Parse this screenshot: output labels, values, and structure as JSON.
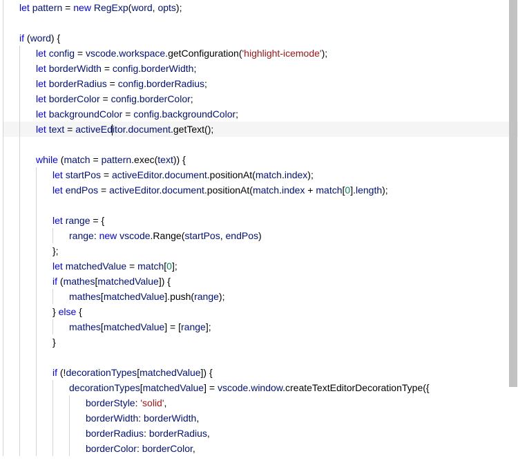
{
  "colors": {
    "keyword": "#0000ff",
    "identifier": "#001080",
    "string": "#a31515",
    "number": "#098658",
    "text": "#000000",
    "bg": "#ffffff",
    "lineHighlight": "#f5f5f5",
    "indentGuide": "#d4d4d4"
  },
  "cursorLineIndex": 8,
  "lines": [
    {
      "indent": 1,
      "tokens": [
        [
          "kw",
          "let"
        ],
        [
          "punct",
          " "
        ],
        [
          "id",
          "pattern"
        ],
        [
          "punct",
          " = "
        ],
        [
          "kw",
          "new"
        ],
        [
          "punct",
          " "
        ],
        [
          "id",
          "RegExp"
        ],
        [
          "punct",
          "("
        ],
        [
          "id",
          "word"
        ],
        [
          "punct",
          ", "
        ],
        [
          "id",
          "opts"
        ],
        [
          "punct",
          ");"
        ]
      ]
    },
    {
      "indent": 1,
      "tokens": []
    },
    {
      "indent": 1,
      "tokens": [
        [
          "kw",
          "if"
        ],
        [
          "punct",
          " ("
        ],
        [
          "id",
          "word"
        ],
        [
          "punct",
          ") {"
        ]
      ]
    },
    {
      "indent": 2,
      "tokens": [
        [
          "kw",
          "let"
        ],
        [
          "punct",
          " "
        ],
        [
          "id",
          "config"
        ],
        [
          "punct",
          " = "
        ],
        [
          "id",
          "vscode"
        ],
        [
          "punct",
          "."
        ],
        [
          "id",
          "workspace"
        ],
        [
          "punct",
          "."
        ],
        [
          "fn",
          "getConfiguration"
        ],
        [
          "punct",
          "("
        ],
        [
          "str",
          "'highlight-icemode'"
        ],
        [
          "punct",
          ");"
        ]
      ]
    },
    {
      "indent": 2,
      "tokens": [
        [
          "kw",
          "let"
        ],
        [
          "punct",
          " "
        ],
        [
          "id",
          "borderWidth"
        ],
        [
          "punct",
          " = "
        ],
        [
          "id",
          "config"
        ],
        [
          "punct",
          "."
        ],
        [
          "id",
          "borderWidth"
        ],
        [
          "punct",
          ";"
        ]
      ]
    },
    {
      "indent": 2,
      "tokens": [
        [
          "kw",
          "let"
        ],
        [
          "punct",
          " "
        ],
        [
          "id",
          "borderRadius"
        ],
        [
          "punct",
          " = "
        ],
        [
          "id",
          "config"
        ],
        [
          "punct",
          "."
        ],
        [
          "id",
          "borderRadius"
        ],
        [
          "punct",
          ";"
        ]
      ]
    },
    {
      "indent": 2,
      "tokens": [
        [
          "kw",
          "let"
        ],
        [
          "punct",
          " "
        ],
        [
          "id",
          "borderColor"
        ],
        [
          "punct",
          " = "
        ],
        [
          "id",
          "config"
        ],
        [
          "punct",
          "."
        ],
        [
          "id",
          "borderColor"
        ],
        [
          "punct",
          ";"
        ]
      ]
    },
    {
      "indent": 2,
      "tokens": [
        [
          "kw",
          "let"
        ],
        [
          "punct",
          " "
        ],
        [
          "id",
          "backgroundColor"
        ],
        [
          "punct",
          " = "
        ],
        [
          "id",
          "config"
        ],
        [
          "punct",
          "."
        ],
        [
          "id",
          "backgroundColor"
        ],
        [
          "punct",
          ";"
        ]
      ]
    },
    {
      "indent": 2,
      "tokens": [
        [
          "kw",
          "let"
        ],
        [
          "punct",
          " "
        ],
        [
          "id",
          "text"
        ],
        [
          "punct",
          " = "
        ],
        [
          "id",
          "activeEd"
        ],
        [
          "cursor",
          ""
        ],
        [
          "id",
          "itor"
        ],
        [
          "punct",
          "."
        ],
        [
          "id",
          "document"
        ],
        [
          "punct",
          "."
        ],
        [
          "fn",
          "getText"
        ],
        [
          "punct",
          "();"
        ]
      ]
    },
    {
      "indent": 2,
      "tokens": []
    },
    {
      "indent": 2,
      "tokens": [
        [
          "kw",
          "while"
        ],
        [
          "punct",
          " ("
        ],
        [
          "id",
          "match"
        ],
        [
          "punct",
          " = "
        ],
        [
          "id",
          "pattern"
        ],
        [
          "punct",
          "."
        ],
        [
          "fn",
          "exec"
        ],
        [
          "punct",
          "("
        ],
        [
          "id",
          "text"
        ],
        [
          "punct",
          ")) {"
        ]
      ]
    },
    {
      "indent": 3,
      "tokens": [
        [
          "kw",
          "let"
        ],
        [
          "punct",
          " "
        ],
        [
          "id",
          "startPos"
        ],
        [
          "punct",
          " = "
        ],
        [
          "id",
          "activeEditor"
        ],
        [
          "punct",
          "."
        ],
        [
          "id",
          "document"
        ],
        [
          "punct",
          "."
        ],
        [
          "fn",
          "positionAt"
        ],
        [
          "punct",
          "("
        ],
        [
          "id",
          "match"
        ],
        [
          "punct",
          "."
        ],
        [
          "id",
          "index"
        ],
        [
          "punct",
          ");"
        ]
      ]
    },
    {
      "indent": 3,
      "tokens": [
        [
          "kw",
          "let"
        ],
        [
          "punct",
          " "
        ],
        [
          "id",
          "endPos"
        ],
        [
          "punct",
          " = "
        ],
        [
          "id",
          "activeEditor"
        ],
        [
          "punct",
          "."
        ],
        [
          "id",
          "document"
        ],
        [
          "punct",
          "."
        ],
        [
          "fn",
          "positionAt"
        ],
        [
          "punct",
          "("
        ],
        [
          "id",
          "match"
        ],
        [
          "punct",
          "."
        ],
        [
          "id",
          "index"
        ],
        [
          "punct",
          " + "
        ],
        [
          "id",
          "match"
        ],
        [
          "punct",
          "["
        ],
        [
          "num",
          "0"
        ],
        [
          "punct",
          "]."
        ],
        [
          "id",
          "length"
        ],
        [
          "punct",
          ");"
        ]
      ]
    },
    {
      "indent": 3,
      "tokens": []
    },
    {
      "indent": 3,
      "tokens": [
        [
          "kw",
          "let"
        ],
        [
          "punct",
          " "
        ],
        [
          "id",
          "range"
        ],
        [
          "punct",
          " = {"
        ]
      ]
    },
    {
      "indent": 4,
      "tokens": [
        [
          "id",
          "range"
        ],
        [
          "punct",
          ": "
        ],
        [
          "kw",
          "new"
        ],
        [
          "punct",
          " "
        ],
        [
          "id",
          "vscode"
        ],
        [
          "punct",
          "."
        ],
        [
          "fn",
          "Range"
        ],
        [
          "punct",
          "("
        ],
        [
          "id",
          "startPos"
        ],
        [
          "punct",
          ", "
        ],
        [
          "id",
          "endPos"
        ],
        [
          "punct",
          ")"
        ]
      ]
    },
    {
      "indent": 3,
      "tokens": [
        [
          "punct",
          "};"
        ]
      ]
    },
    {
      "indent": 3,
      "tokens": [
        [
          "kw",
          "let"
        ],
        [
          "punct",
          " "
        ],
        [
          "id",
          "matchedValue"
        ],
        [
          "punct",
          " = "
        ],
        [
          "id",
          "match"
        ],
        [
          "punct",
          "["
        ],
        [
          "num",
          "0"
        ],
        [
          "punct",
          "];"
        ]
      ]
    },
    {
      "indent": 3,
      "tokens": [
        [
          "kw",
          "if"
        ],
        [
          "punct",
          " ("
        ],
        [
          "id",
          "mathes"
        ],
        [
          "punct",
          "["
        ],
        [
          "id",
          "matchedValue"
        ],
        [
          "punct",
          "]) {"
        ]
      ]
    },
    {
      "indent": 4,
      "tokens": [
        [
          "id",
          "mathes"
        ],
        [
          "punct",
          "["
        ],
        [
          "id",
          "matchedValue"
        ],
        [
          "punct",
          "]."
        ],
        [
          "fn",
          "push"
        ],
        [
          "punct",
          "("
        ],
        [
          "id",
          "range"
        ],
        [
          "punct",
          ");"
        ]
      ]
    },
    {
      "indent": 3,
      "tokens": [
        [
          "punct",
          "} "
        ],
        [
          "kw",
          "else"
        ],
        [
          "punct",
          " {"
        ]
      ]
    },
    {
      "indent": 4,
      "tokens": [
        [
          "id",
          "mathes"
        ],
        [
          "punct",
          "["
        ],
        [
          "id",
          "matchedValue"
        ],
        [
          "punct",
          "] = ["
        ],
        [
          "id",
          "range"
        ],
        [
          "punct",
          "];"
        ]
      ]
    },
    {
      "indent": 3,
      "tokens": [
        [
          "punct",
          "}"
        ]
      ]
    },
    {
      "indent": 3,
      "tokens": []
    },
    {
      "indent": 3,
      "tokens": [
        [
          "kw",
          "if"
        ],
        [
          "punct",
          " (!"
        ],
        [
          "id",
          "decorationTypes"
        ],
        [
          "punct",
          "["
        ],
        [
          "id",
          "matchedValue"
        ],
        [
          "punct",
          "]) {"
        ]
      ]
    },
    {
      "indent": 4,
      "tokens": [
        [
          "id",
          "decorationTypes"
        ],
        [
          "punct",
          "["
        ],
        [
          "id",
          "matchedValue"
        ],
        [
          "punct",
          "] = "
        ],
        [
          "id",
          "vscode"
        ],
        [
          "punct",
          "."
        ],
        [
          "id",
          "window"
        ],
        [
          "punct",
          "."
        ],
        [
          "fn",
          "createTextEditorDecorationType"
        ],
        [
          "punct",
          "({"
        ]
      ]
    },
    {
      "indent": 5,
      "tokens": [
        [
          "id",
          "borderStyle"
        ],
        [
          "punct",
          ": "
        ],
        [
          "str",
          "'solid'"
        ],
        [
          "punct",
          ","
        ]
      ]
    },
    {
      "indent": 5,
      "tokens": [
        [
          "id",
          "borderWidth"
        ],
        [
          "punct",
          ": "
        ],
        [
          "id",
          "borderWidth"
        ],
        [
          "punct",
          ","
        ]
      ]
    },
    {
      "indent": 5,
      "tokens": [
        [
          "id",
          "borderRadius"
        ],
        [
          "punct",
          ": "
        ],
        [
          "id",
          "borderRadius"
        ],
        [
          "punct",
          ","
        ]
      ]
    },
    {
      "indent": 5,
      "tokens": [
        [
          "id",
          "borderColor"
        ],
        [
          "punct",
          ": "
        ],
        [
          "id",
          "borderColor"
        ],
        [
          "punct",
          ","
        ]
      ]
    }
  ]
}
